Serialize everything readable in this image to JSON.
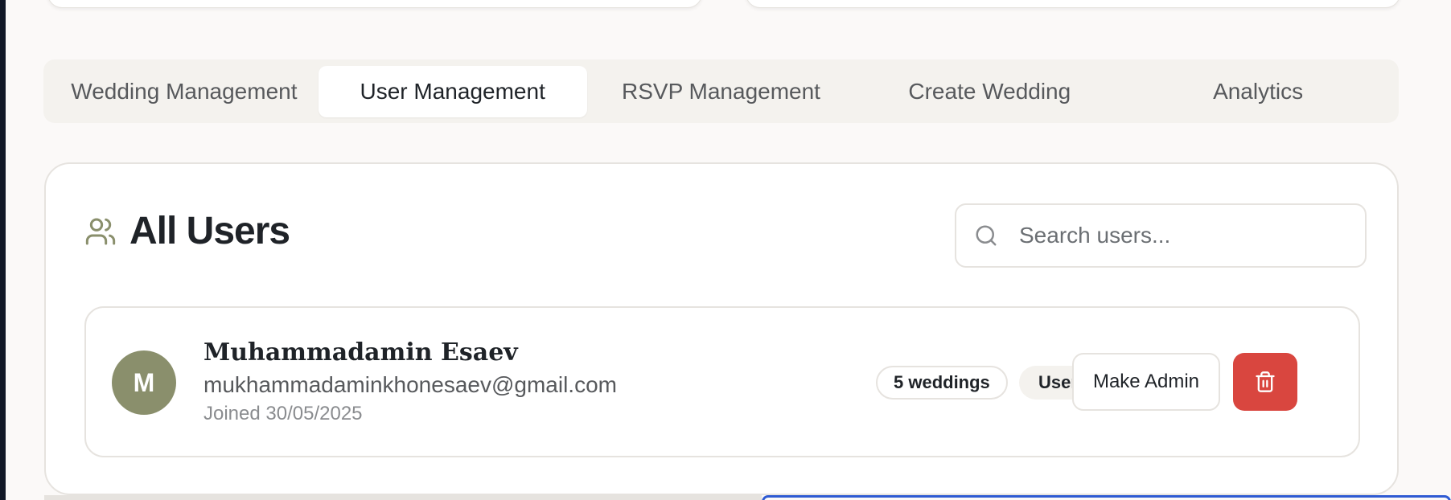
{
  "tabs": [
    {
      "label": "Wedding Management",
      "active": false
    },
    {
      "label": "User Management",
      "active": true
    },
    {
      "label": "RSVP Management",
      "active": false
    },
    {
      "label": "Create Wedding",
      "active": false
    },
    {
      "label": "Analytics",
      "active": false
    }
  ],
  "panel": {
    "title": "All Users",
    "icon": "users-icon"
  },
  "search": {
    "placeholder": "Search users...",
    "value": "",
    "icon": "search-icon"
  },
  "users": [
    {
      "avatar_initial": "M",
      "name": "Muhammadamin Esaev",
      "email": "mukhammadaminkhonesaev@gmail.com",
      "joined": "Joined 30/05/2025",
      "weddings_badge": "5 weddings",
      "role": "User",
      "make_admin_label": "Make Admin",
      "delete_icon": "trash-icon"
    }
  ],
  "colors": {
    "accent": "#8a8f6c",
    "danger": "#d9463f",
    "focus": "#2f5bd3"
  }
}
